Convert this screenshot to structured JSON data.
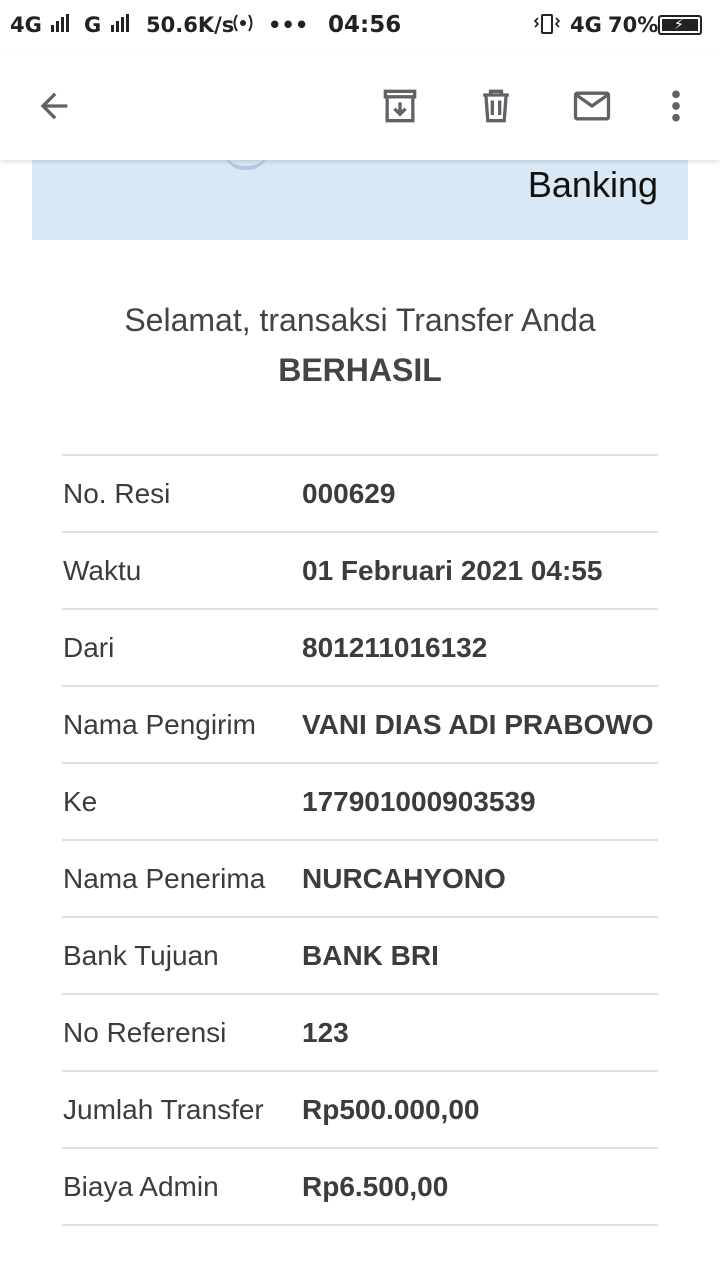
{
  "status_bar": {
    "network_left": "4G",
    "network_mid": "G",
    "speed": "50.6K/s",
    "hotspot_icon": "hotspot-icon",
    "more_dots": "•••",
    "time": "04:56",
    "vibrate_icon": "vibrate-icon",
    "network_right": "4G",
    "battery": "70%"
  },
  "toolbar": {
    "back_icon": "arrow-left-icon",
    "archive_icon": "archive-icon",
    "delete_icon": "trash-icon",
    "mail_icon": "mail-icon",
    "more_icon": "more-vertical-icon"
  },
  "banner": {
    "text": "Banking",
    "background": "#d8e8f5"
  },
  "message": {
    "headline": "Selamat, transaksi Transfer Anda",
    "status": "BERHASIL"
  },
  "details": [
    {
      "label": "No. Resi",
      "value": "000629"
    },
    {
      "label": "Waktu",
      "value": "01 Februari 2021 04:55"
    },
    {
      "label": "Dari",
      "value": "801211016132"
    },
    {
      "label": "Nama Pengirim",
      "value": "VANI DIAS ADI PRABOWO"
    },
    {
      "label": "Ke",
      "value": "177901000903539"
    },
    {
      "label": "Nama Penerima",
      "value": "NURCAHYONO"
    },
    {
      "label": "Bank Tujuan",
      "value": "BANK BRI"
    },
    {
      "label": "No Referensi",
      "value": "123"
    },
    {
      "label": "Jumlah Transfer",
      "value": "Rp500.000,00"
    },
    {
      "label": "Biaya Admin",
      "value": "Rp6.500,00"
    }
  ]
}
